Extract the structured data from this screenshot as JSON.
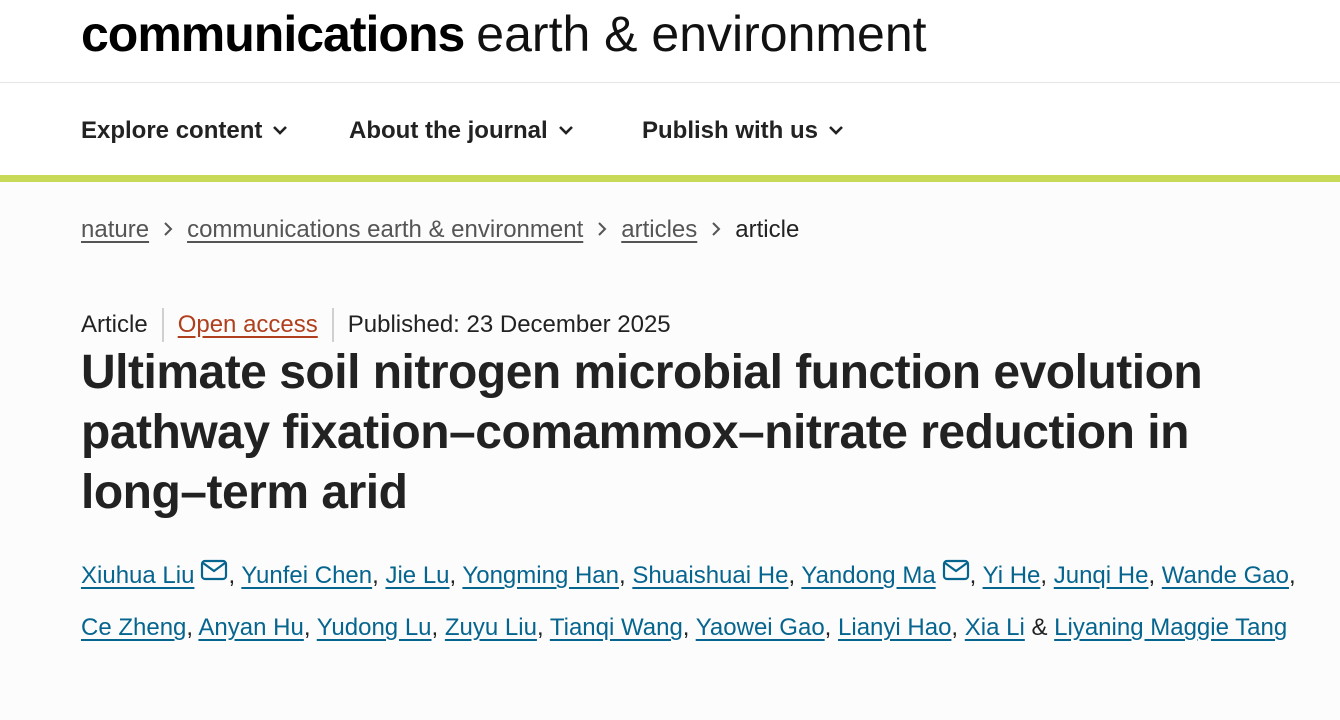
{
  "masthead": {
    "logo_bold": "communications",
    "logo_light": "earth & environment"
  },
  "nav": {
    "items": [
      {
        "label": "Explore content",
        "icon": "chevron-down-icon"
      },
      {
        "label": "About the journal",
        "icon": "chevron-down-icon"
      },
      {
        "label": "Publish with us",
        "icon": "chevron-down-icon"
      }
    ]
  },
  "breadcrumb": {
    "items": [
      "nature",
      "communications earth & environment",
      "articles"
    ],
    "current": "article"
  },
  "meta": {
    "type": "Article",
    "access": "Open access",
    "published": "Published: 23 December 2025"
  },
  "article": {
    "title": "Ultimate soil nitrogen microbial function evolution pathway fixation–comammox–nitrate reduction in long–term arid"
  },
  "authors": {
    "list": [
      {
        "name": "Xiuhua Liu",
        "corresponding": true
      },
      {
        "name": "Yunfei Chen"
      },
      {
        "name": "Jie Lu"
      },
      {
        "name": "Yongming Han"
      },
      {
        "name": "Shuaishuai He"
      },
      {
        "name": "Yandong Ma",
        "corresponding": true
      },
      {
        "name": "Yi He"
      },
      {
        "name": "Junqi He"
      },
      {
        "name": "Wande Gao"
      },
      {
        "name": "Ce Zheng"
      },
      {
        "name": "Anyan Hu"
      },
      {
        "name": "Yudong Lu"
      },
      {
        "name": "Zuyu Liu"
      },
      {
        "name": "Tianqi Wang"
      },
      {
        "name": "Yaowei Gao"
      },
      {
        "name": "Lianyi Hao"
      },
      {
        "name": "Xia Li"
      },
      {
        "name": "Liyaning Maggie Tang"
      }
    ],
    "separator": ", ",
    "last_separator": " & ",
    "mail_icon": "envelope-icon"
  },
  "colors": {
    "accent_bar": "#c8d957",
    "link": "#06658f",
    "open_access": "#b0401d",
    "text": "#222222"
  }
}
